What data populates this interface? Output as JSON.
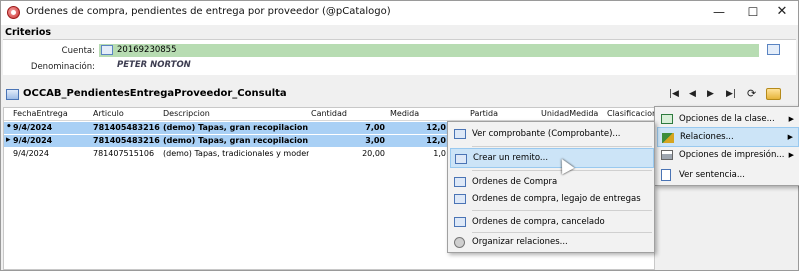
{
  "window": {
    "title": "Ordenes de compra, pendientes de entrega por proveedor (@pCatalogo)",
    "buttons": {
      "minimize": "—",
      "maximize": "☐",
      "close": "✕"
    }
  },
  "criterios": {
    "label": "Criterios",
    "cuenta_label": "Cuenta:",
    "cuenta_value": "20169230855",
    "denominacion_label": "Denominación:",
    "denominacion_value": "PETER NORTON"
  },
  "grid": {
    "title": "OCCAB_PendientesEntregaProveedor_Consulta",
    "nav": {
      "first": "|◀",
      "prev": "◀",
      "next": "▶",
      "last": "▶|",
      "refresh": "⟳"
    },
    "columns": [
      "FechaEntrega",
      "Articulo",
      "Descripcion",
      "Cantidad",
      "Medida",
      "Partida",
      "UnidadMedida",
      "Clasificacion"
    ],
    "rows": [
      {
        "indicator": "•",
        "fecha": "9/4/2024",
        "articulo": "781405483216",
        "descripcion": "(demo) Tapas, gran recopilacion",
        "cantidad": "7,00",
        "medida": "12,0",
        "selected": true
      },
      {
        "indicator": "▸",
        "fecha": "9/4/2024",
        "articulo": "781405483216",
        "descripcion": "(demo) Tapas, gran recopilacion",
        "cantidad": "3,00",
        "medida": "12,0",
        "selected": true
      },
      {
        "indicator": "",
        "fecha": "9/4/2024",
        "articulo": "781407515106",
        "descripcion": "(demo) Tapas, tradicionales y moderna",
        "cantidad": "20,00",
        "medida": "1,0",
        "selected": false
      }
    ]
  },
  "context_menu": {
    "items": [
      {
        "label": "Ver comprobante (Comprobante)...",
        "icon": "document-icon"
      },
      {
        "label": "Crear un remito...",
        "icon": "form-icon",
        "highlighted": true
      },
      {
        "label": "Ordenes de Compra",
        "icon": "form-icon"
      },
      {
        "label": "Ordenes de compra, legajo de entregas",
        "icon": "grid-icon"
      },
      {
        "label": "Ordenes de compra, cancelado",
        "icon": "form-icon"
      },
      {
        "label": "Organizar relaciones...",
        "icon": "gear-icon"
      }
    ]
  },
  "side_menu": {
    "items": [
      {
        "label": "Opciones de la clase...",
        "icon": "class-icon",
        "submenu": true
      },
      {
        "label": "Relaciones...",
        "icon": "relations-icon",
        "submenu": true,
        "highlighted": true
      },
      {
        "label": "Opciones de impresión...",
        "icon": "print-icon",
        "submenu": true
      },
      {
        "label": "Ver sentencia...",
        "icon": "document-icon",
        "submenu": false
      }
    ]
  }
}
